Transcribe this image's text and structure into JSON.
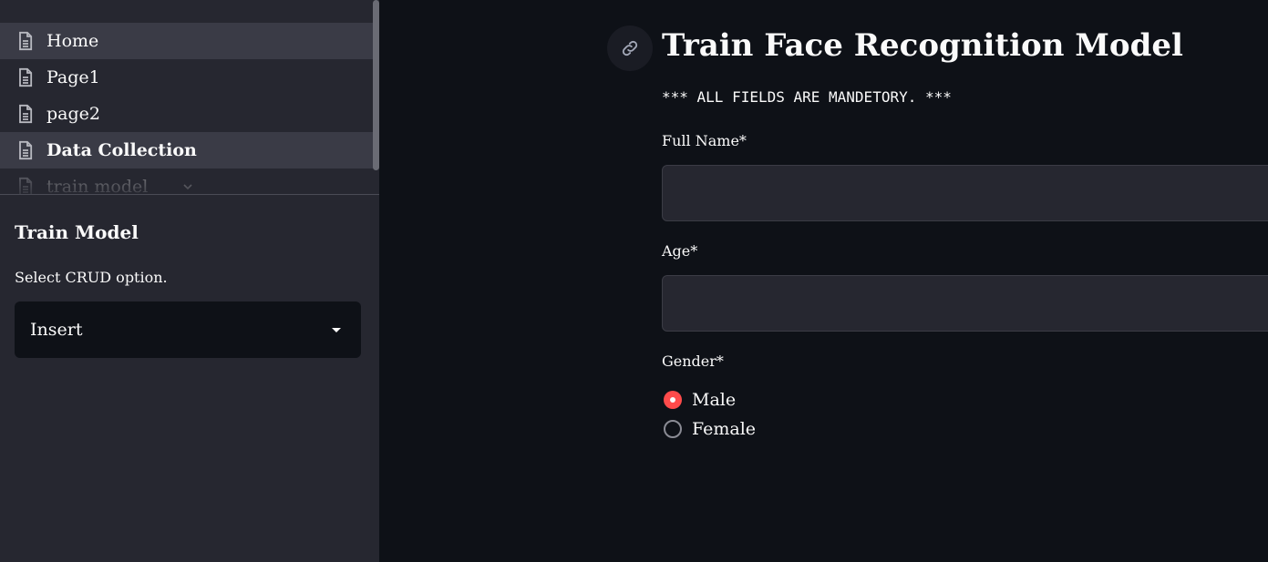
{
  "sidebar": {
    "nav": [
      {
        "label": "Home",
        "icon": "document-icon"
      },
      {
        "label": "Page1",
        "icon": "document-icon"
      },
      {
        "label": "page2",
        "icon": "document-icon"
      },
      {
        "label": "Data Collection",
        "icon": "document-icon"
      },
      {
        "label": "train model",
        "icon": "document-icon"
      }
    ],
    "expand_icon": "chevron-down-icon",
    "section_title": "Train Model",
    "select_label": "Select CRUD option.",
    "select_value": "Insert",
    "select_icon": "caret-down-icon"
  },
  "main": {
    "anchor_icon": "link-icon",
    "title": "Train Face Recognition Model",
    "notice": "*** ALL FIELDS ARE MANDETORY. ***",
    "full_name": {
      "label": "Full Name*",
      "value": ""
    },
    "age": {
      "label": "Age*",
      "value": ""
    },
    "gender": {
      "label": "Gender*",
      "options": [
        "Male",
        "Female"
      ],
      "selected": "Male"
    }
  },
  "colors": {
    "app_bg": "#0e1117",
    "sidebar_bg": "#262730",
    "accent": "#ff4b4b",
    "text": "#fafafa"
  }
}
